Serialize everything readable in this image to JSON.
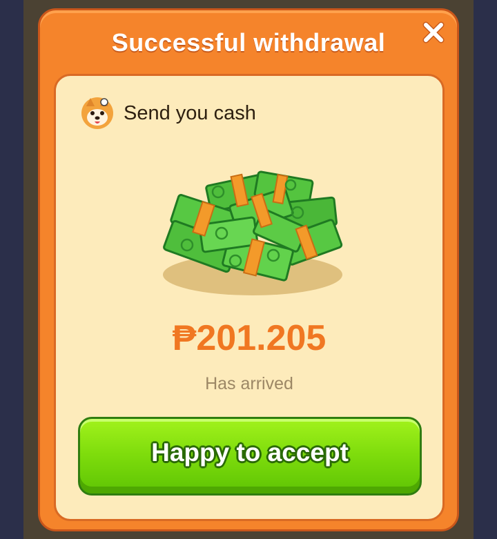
{
  "dialog": {
    "title": "Successful withdrawal",
    "close_icon": "close-icon",
    "sender": {
      "avatar_icon": "dog-avatar-icon",
      "text": "Send you cash"
    },
    "illustration_icon": "money-stack-icon",
    "amount": "₱201.205",
    "status": "Has arrived",
    "accept_button": {
      "label": "Happy to accept"
    }
  },
  "colors": {
    "dialog_bg": "#f5842b",
    "card_bg": "#fdebbb",
    "amount": "#f07722",
    "button_green": "#7edc0c"
  }
}
